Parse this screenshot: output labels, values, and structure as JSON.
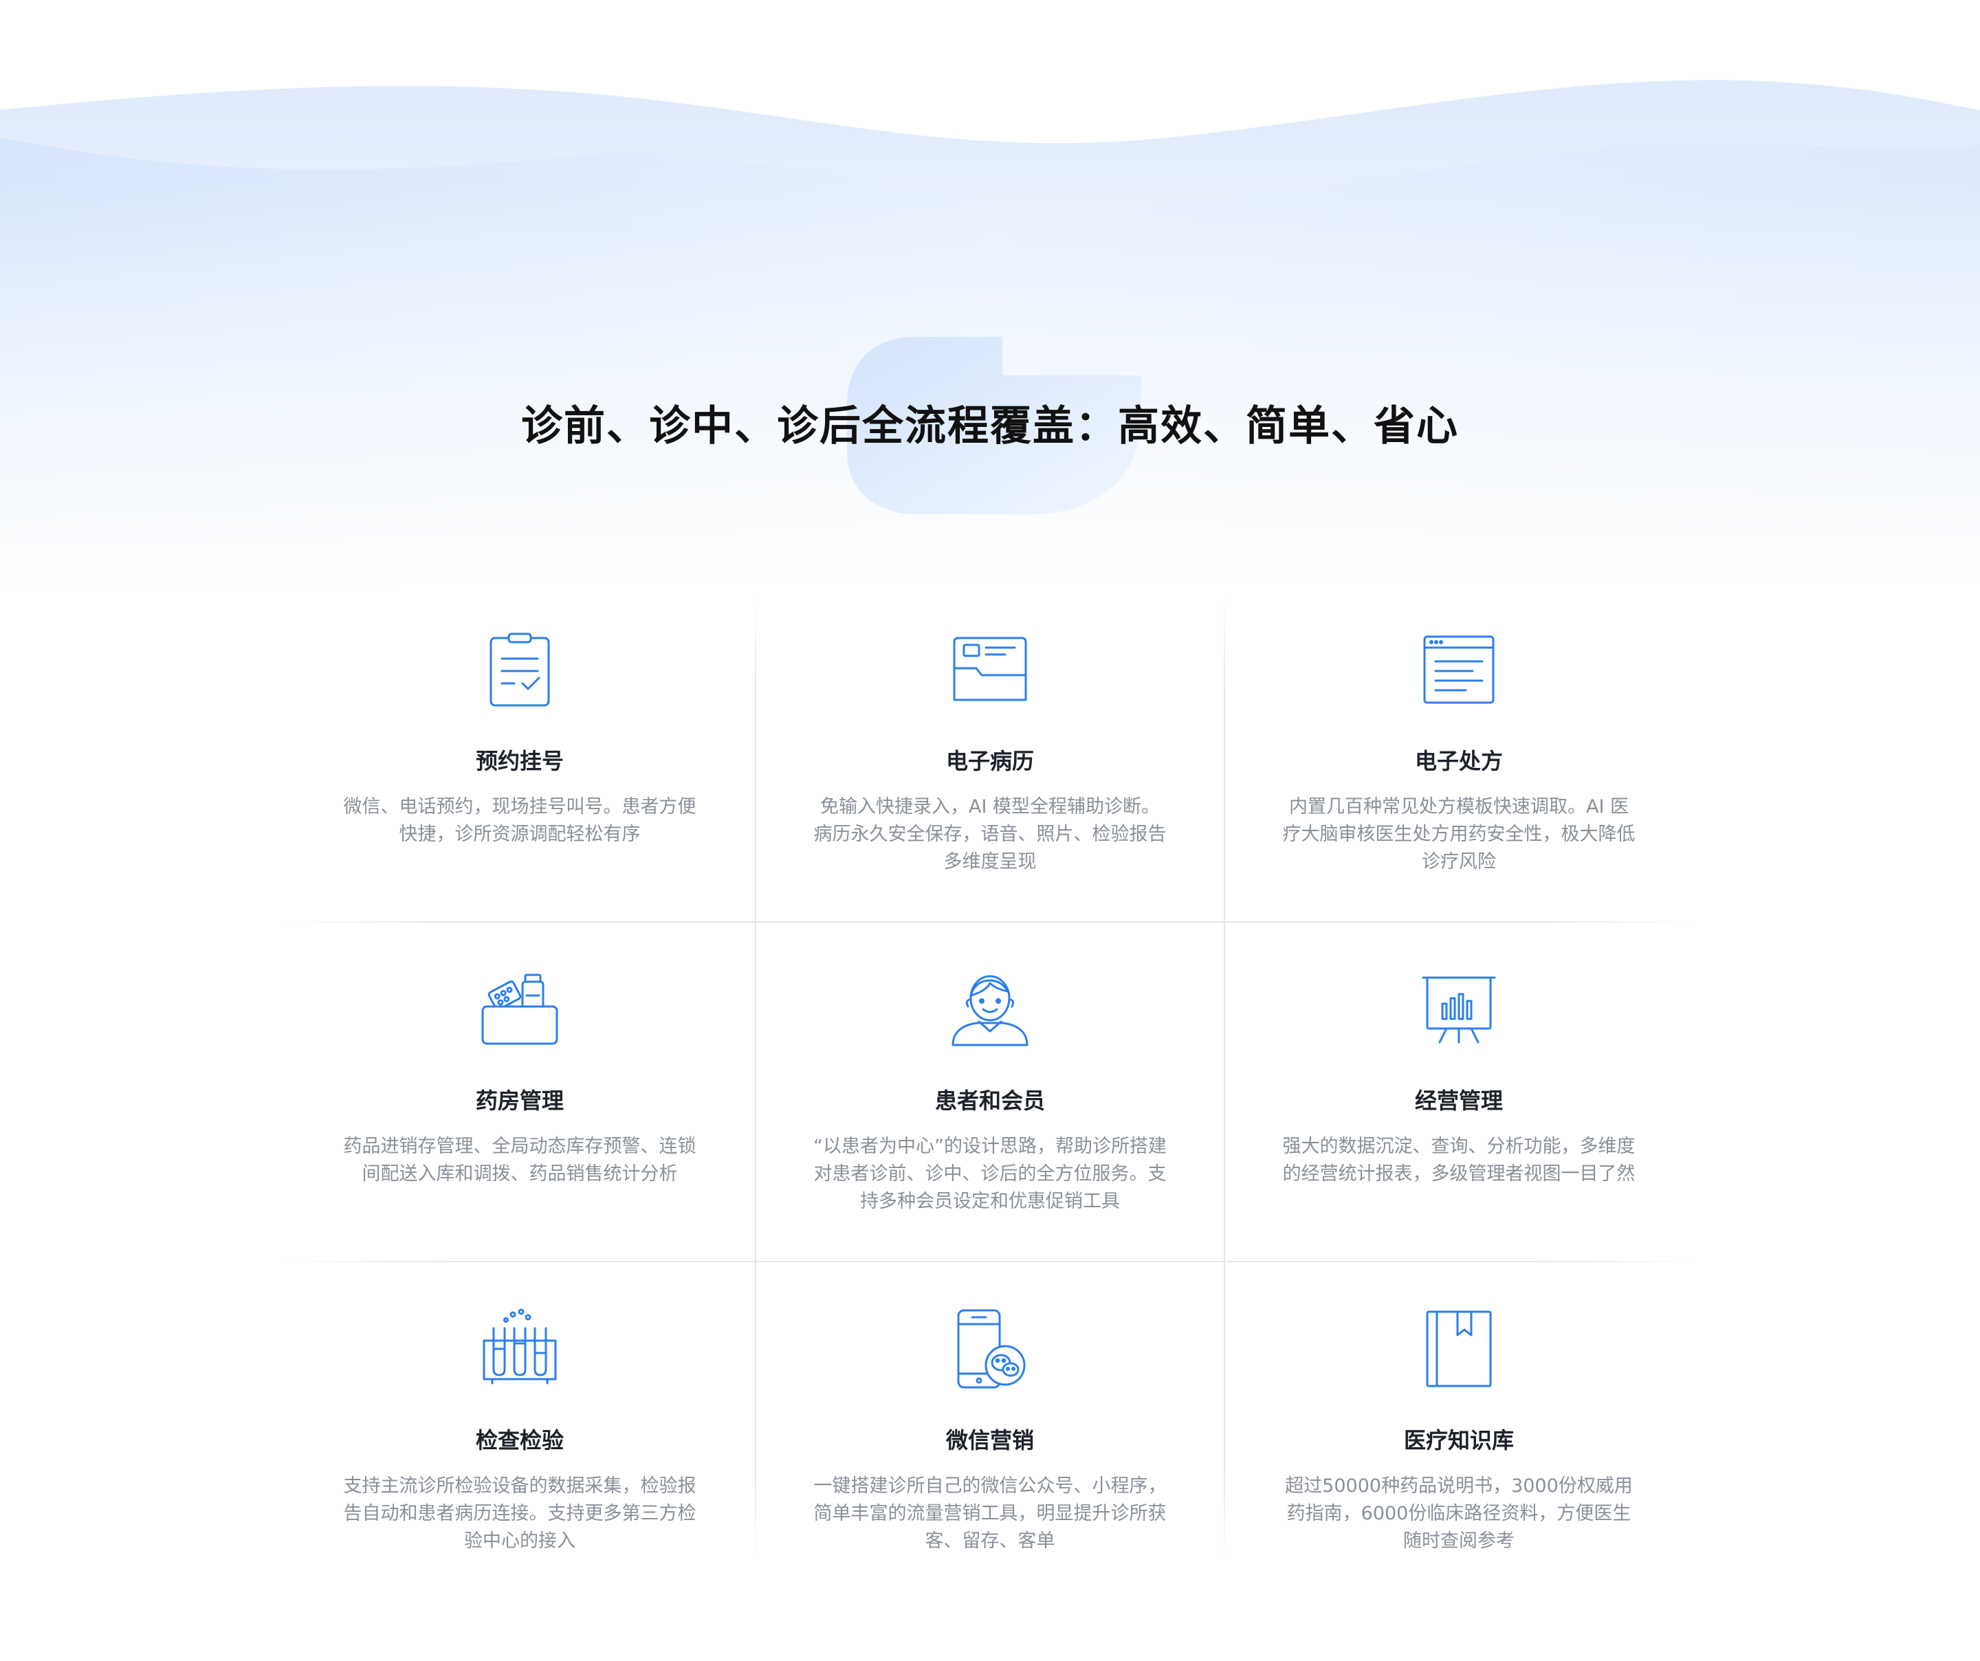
{
  "hero": {
    "title": "诊前、诊中、诊后全流程覆盖：高效、简单、省心"
  },
  "colors": {
    "accent": "#2b7fec",
    "title": "#111111",
    "card_title": "#1d2129",
    "card_desc": "#8a9099",
    "wave_light": "#eaf2fd",
    "wave_mid": "#d6e6fb"
  },
  "features": [
    {
      "icon": "clipboard-check-icon",
      "title": "预约挂号",
      "desc": "微信、电话预约，现场挂号叫号。患者方便快捷，诊所资源调配轻松有序"
    },
    {
      "icon": "medical-folder-icon",
      "title": "电子病历",
      "desc": "免输入快捷录入，AI 模型全程辅助诊断。病历永久安全保存，语音、照片、检验报告多维度呈现"
    },
    {
      "icon": "prescription-window-icon",
      "title": "电子处方",
      "desc": "内置几百种常见处方模板快速调取。AI 医疗大脑审核医生处方用药安全性，极大降低诊疗风险"
    },
    {
      "icon": "medicine-box-icon",
      "title": "药房管理",
      "desc": "药品进销存管理、全局动态库存预警、连锁间配送入库和调拨、药品销售统计分析"
    },
    {
      "icon": "patient-avatar-icon",
      "title": "患者和会员",
      "desc": "“以患者为中心”的设计思路，帮助诊所搭建对患者诊前、诊中、诊后的全方位服务。支持多种会员设定和优惠促销工具"
    },
    {
      "icon": "presentation-chart-icon",
      "title": "经营管理",
      "desc": "强大的数据沉淀、查询、分析功能，多维度的经营统计报表，多级管理者视图一目了然"
    },
    {
      "icon": "test-tubes-icon",
      "title": "检查检验",
      "desc": "支持主流诊所检验设备的数据采集，检验报告自动和患者病历连接。支持更多第三方检验中心的接入"
    },
    {
      "icon": "phone-wechat-icon",
      "title": "微信营销",
      "desc": "一键搭建诊所自己的微信公众号、小程序，简单丰富的流量营销工具，明显提升诊所获客、留存、客单"
    },
    {
      "icon": "bookmark-book-icon",
      "title": "医疗知识库",
      "desc": "超过50000种药品说明书，3000份权威用药指南，6000份临床路径资料，方便医生随时查阅参考"
    }
  ]
}
